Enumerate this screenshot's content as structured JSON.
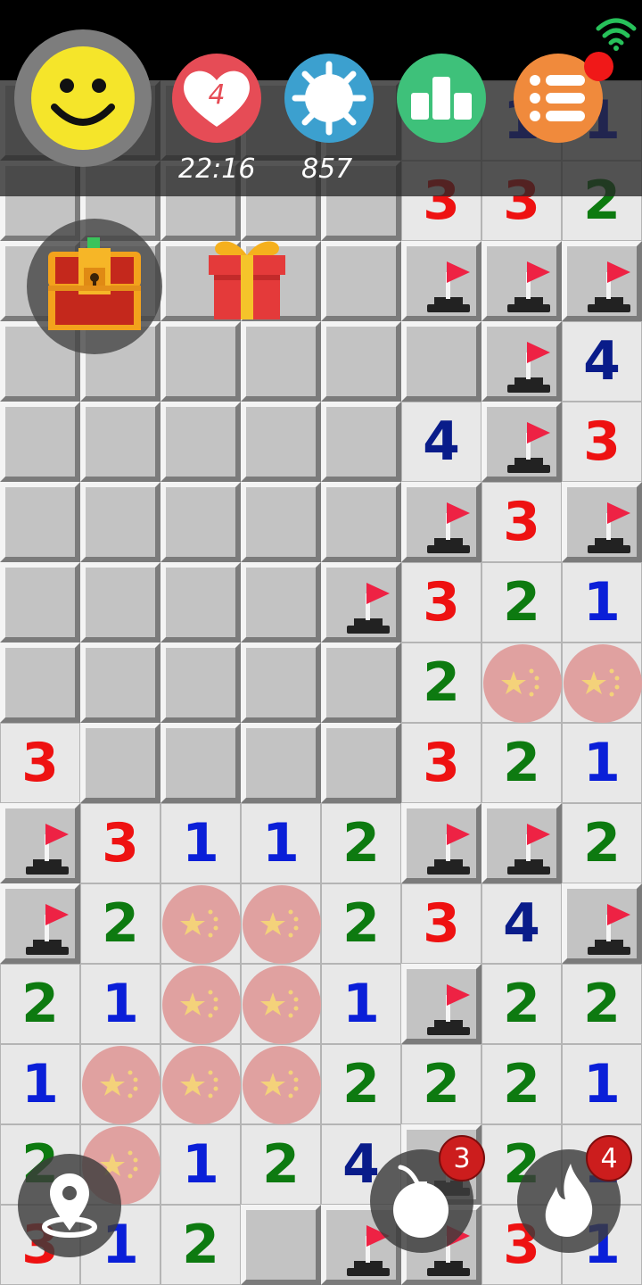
{
  "hud": {
    "timer": "22:16",
    "mines_remaining": "857",
    "lives": "4",
    "notification_dot": true
  },
  "powerups": {
    "bomb_count": "3",
    "fire_count": "4"
  },
  "colors": {
    "n1": "#0a1fd8",
    "n2": "#0d7a10",
    "n3": "#ee1111",
    "n4": "#091c8a",
    "smiley": "#f5e52a",
    "heart_button": "#e64c56",
    "gear_button": "#3ca0cf",
    "stats_button": "#3ec17a",
    "menu_button": "#f08a3c"
  },
  "board": {
    "columns": 8,
    "rows": 15,
    "legend": "H = hidden, F = flag on hidden tile, f = flag on open tile, C = revealed china marker, 0 = empty open, digits = open number",
    "rows_data": [
      "HHHHH111",
      "HHHHH332",
      "HHHHHFFF",
      "HHHHHHF4",
      "HHHHH4F3",
      "HHHHHF3F",
      "HHHHF321",
      "HHHHH2CC",
      "3HHHH321",
      "F3112FF2",
      "F2CC234F",
      "21CC1F22",
      "1CCC2221",
      "2C124F21",
      "312HFF31"
    ]
  }
}
